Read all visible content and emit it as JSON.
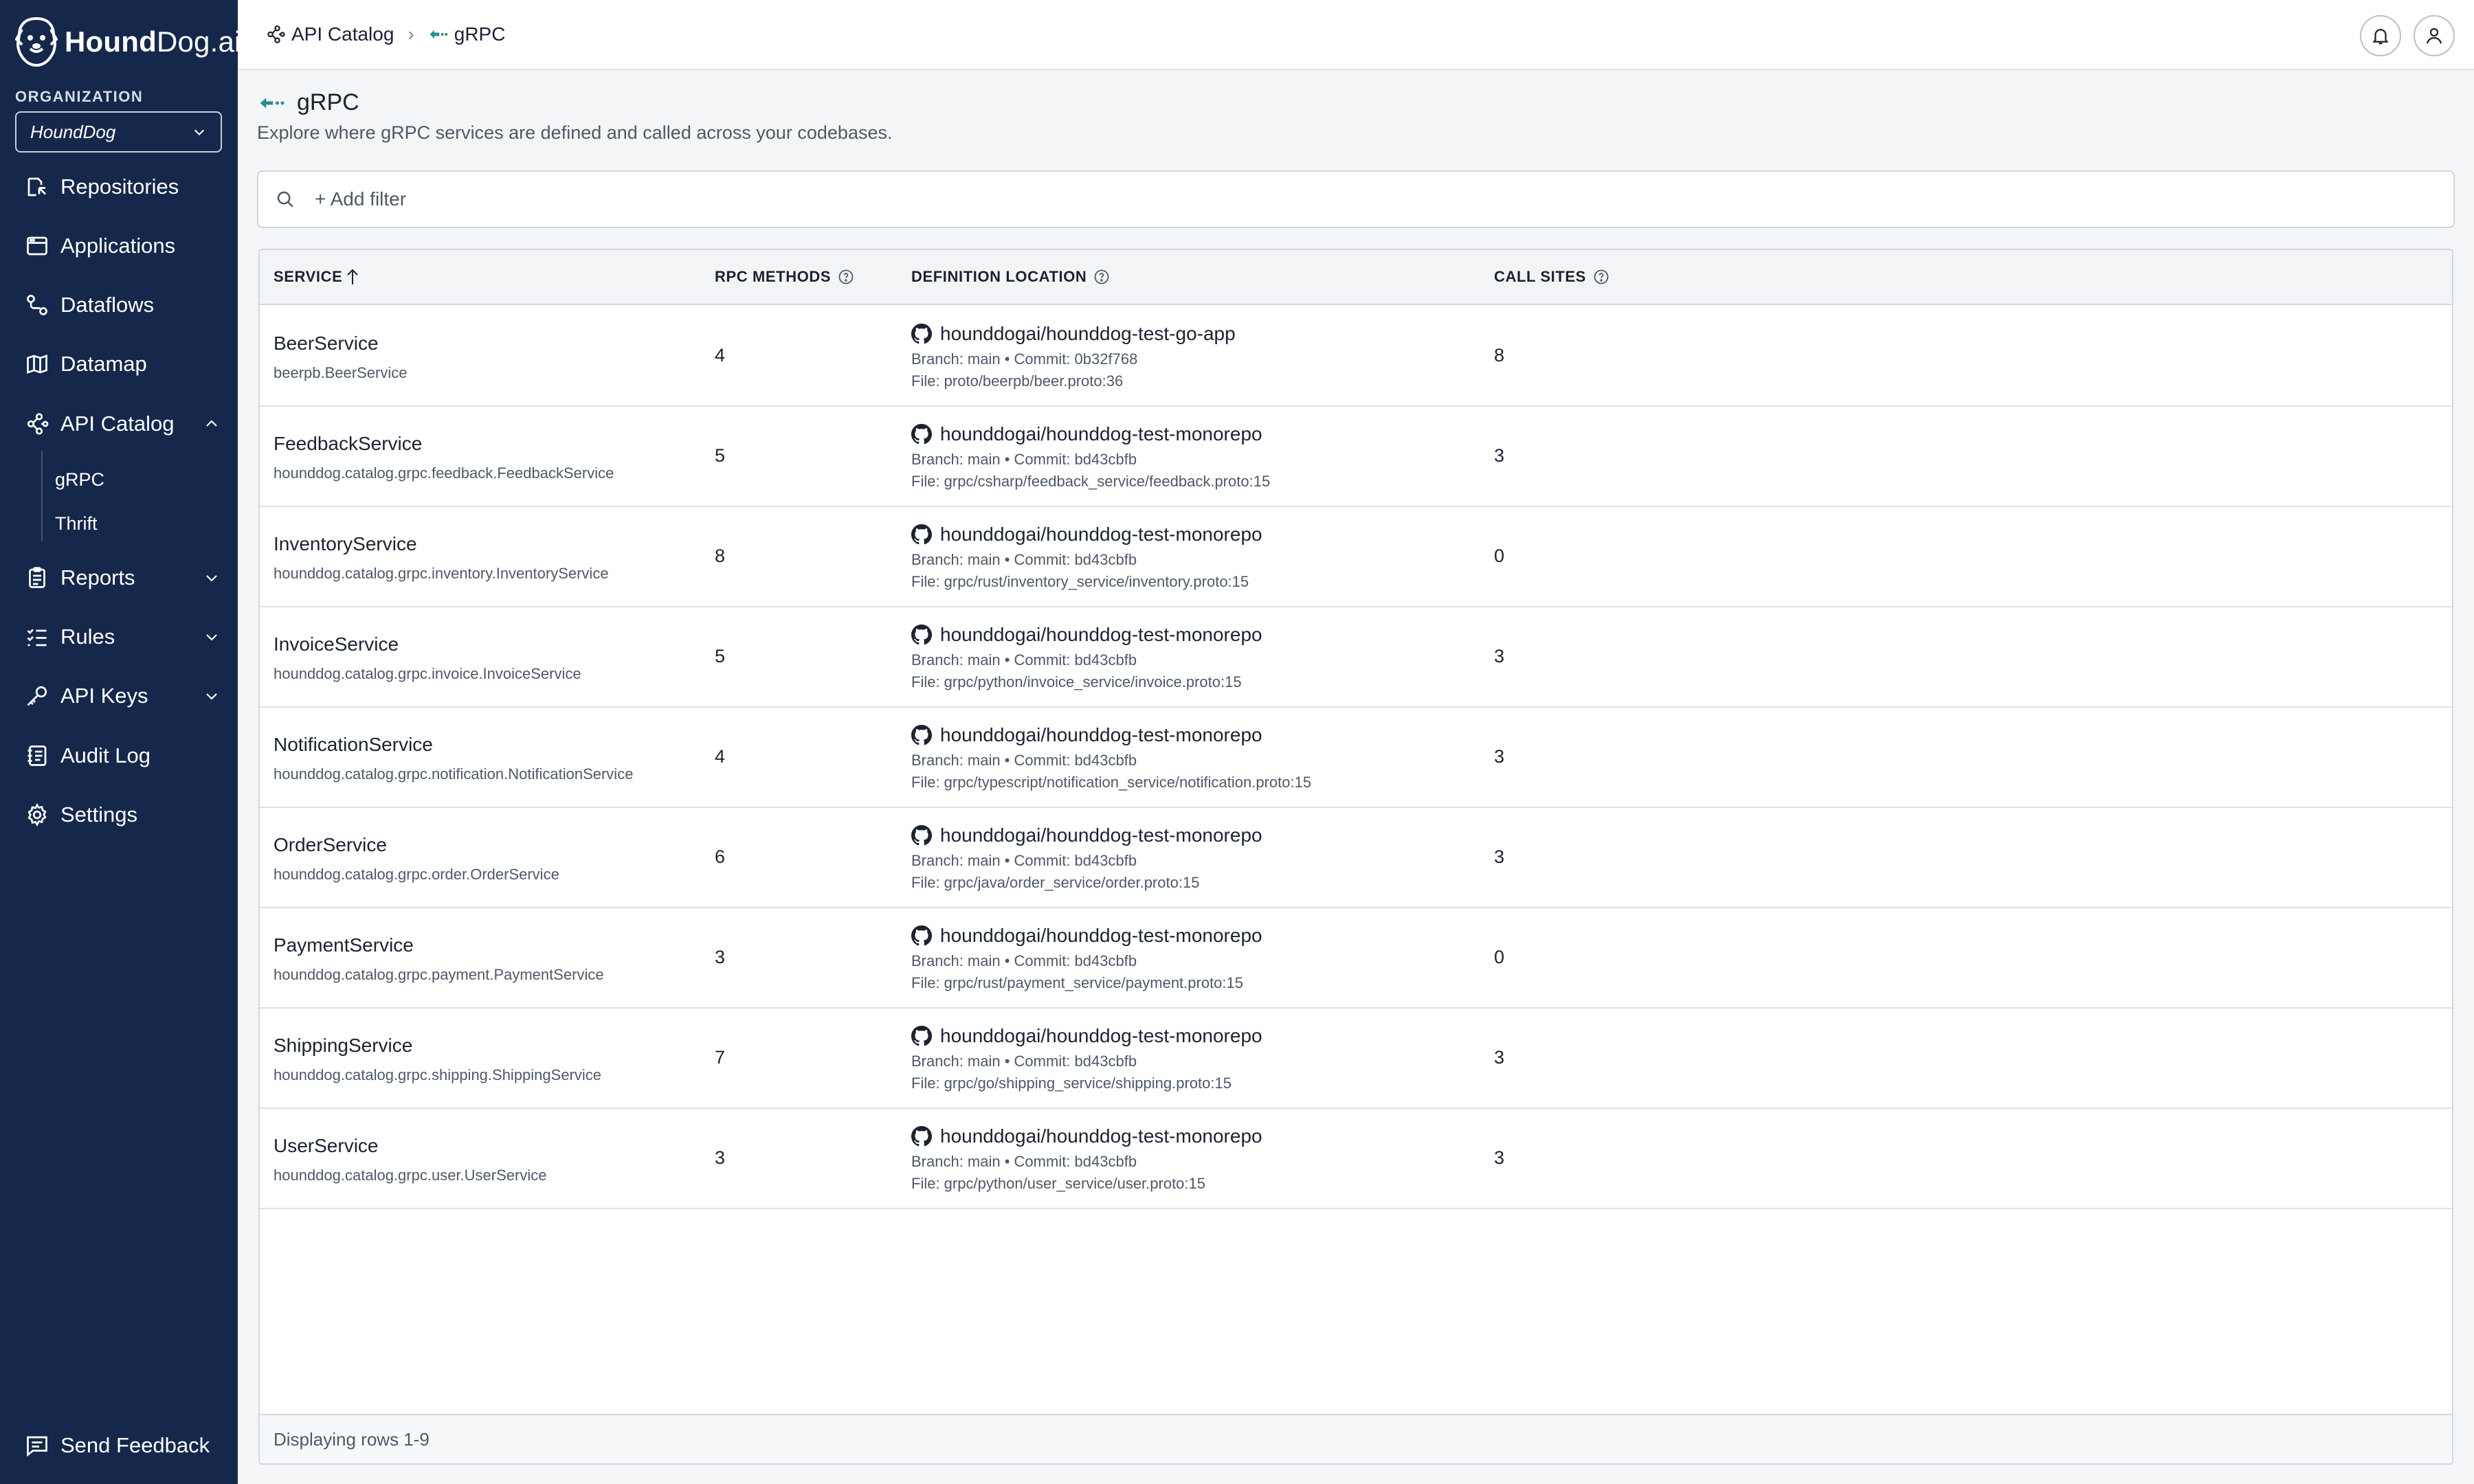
{
  "brand": {
    "name_bold": "Hound",
    "name_rest": "Dog.ai"
  },
  "organization": {
    "label": "ORGANIZATION",
    "selected": "HoundDog"
  },
  "nav": {
    "repositories": "Repositories",
    "applications": "Applications",
    "dataflows": "Dataflows",
    "datamap": "Datamap",
    "api_catalog": "API Catalog",
    "api_catalog_children": [
      "gRPC",
      "Thrift"
    ],
    "reports": "Reports",
    "rules": "Rules",
    "api_keys": "API Keys",
    "audit_log": "Audit Log",
    "settings": "Settings",
    "send_feedback": "Send Feedback"
  },
  "breadcrumb": {
    "parent": "API Catalog",
    "current": "gRPC"
  },
  "page": {
    "title": "gRPC",
    "description": "Explore where gRPC services are defined and called across your codebases."
  },
  "filter": {
    "add_label": "+ Add filter"
  },
  "table": {
    "headers": {
      "service": "SERVICE",
      "rpc_methods": "RPC METHODS",
      "definition_location": "DEFINITION LOCATION",
      "call_sites": "CALL SITES"
    },
    "rows": [
      {
        "name": "BeerService",
        "full": "beerpb.BeerService",
        "rpc": "4",
        "repo": "hounddogai/hounddog-test-go-app",
        "branch": "Branch: main • Commit: 0b32f768",
        "file": "File: proto/beerpb/beer.proto:36",
        "calls": "8"
      },
      {
        "name": "FeedbackService",
        "full": "hounddog.catalog.grpc.feedback.FeedbackService",
        "rpc": "5",
        "repo": "hounddogai/hounddog-test-monorepo",
        "branch": "Branch: main • Commit: bd43cbfb",
        "file": "File: grpc/csharp/feedback_service/feedback.proto:15",
        "calls": "3"
      },
      {
        "name": "InventoryService",
        "full": "hounddog.catalog.grpc.inventory.InventoryService",
        "rpc": "8",
        "repo": "hounddogai/hounddog-test-monorepo",
        "branch": "Branch: main • Commit: bd43cbfb",
        "file": "File: grpc/rust/inventory_service/inventory.proto:15",
        "calls": "0"
      },
      {
        "name": "InvoiceService",
        "full": "hounddog.catalog.grpc.invoice.InvoiceService",
        "rpc": "5",
        "repo": "hounddogai/hounddog-test-monorepo",
        "branch": "Branch: main • Commit: bd43cbfb",
        "file": "File: grpc/python/invoice_service/invoice.proto:15",
        "calls": "3"
      },
      {
        "name": "NotificationService",
        "full": "hounddog.catalog.grpc.notification.NotificationService",
        "rpc": "4",
        "repo": "hounddogai/hounddog-test-monorepo",
        "branch": "Branch: main • Commit: bd43cbfb",
        "file": "File: grpc/typescript/notification_service/notification.proto:15",
        "calls": "3"
      },
      {
        "name": "OrderService",
        "full": "hounddog.catalog.grpc.order.OrderService",
        "rpc": "6",
        "repo": "hounddogai/hounddog-test-monorepo",
        "branch": "Branch: main • Commit: bd43cbfb",
        "file": "File: grpc/java/order_service/order.proto:15",
        "calls": "3"
      },
      {
        "name": "PaymentService",
        "full": "hounddog.catalog.grpc.payment.PaymentService",
        "rpc": "3",
        "repo": "hounddogai/hounddog-test-monorepo",
        "branch": "Branch: main • Commit: bd43cbfb",
        "file": "File: grpc/rust/payment_service/payment.proto:15",
        "calls": "0"
      },
      {
        "name": "ShippingService",
        "full": "hounddog.catalog.grpc.shipping.ShippingService",
        "rpc": "7",
        "repo": "hounddogai/hounddog-test-monorepo",
        "branch": "Branch: main • Commit: bd43cbfb",
        "file": "File: grpc/go/shipping_service/shipping.proto:15",
        "calls": "3"
      },
      {
        "name": "UserService",
        "full": "hounddog.catalog.grpc.user.UserService",
        "rpc": "3",
        "repo": "hounddogai/hounddog-test-monorepo",
        "branch": "Branch: main • Commit: bd43cbfb",
        "file": "File: grpc/python/user_service/user.proto:15",
        "calls": "3"
      }
    ],
    "footer": "Displaying rows 1-9"
  },
  "colors": {
    "sidebar_bg": "#15284b",
    "accent": "#2a8c8c",
    "text": "#1b2230",
    "muted": "#4e5868"
  }
}
